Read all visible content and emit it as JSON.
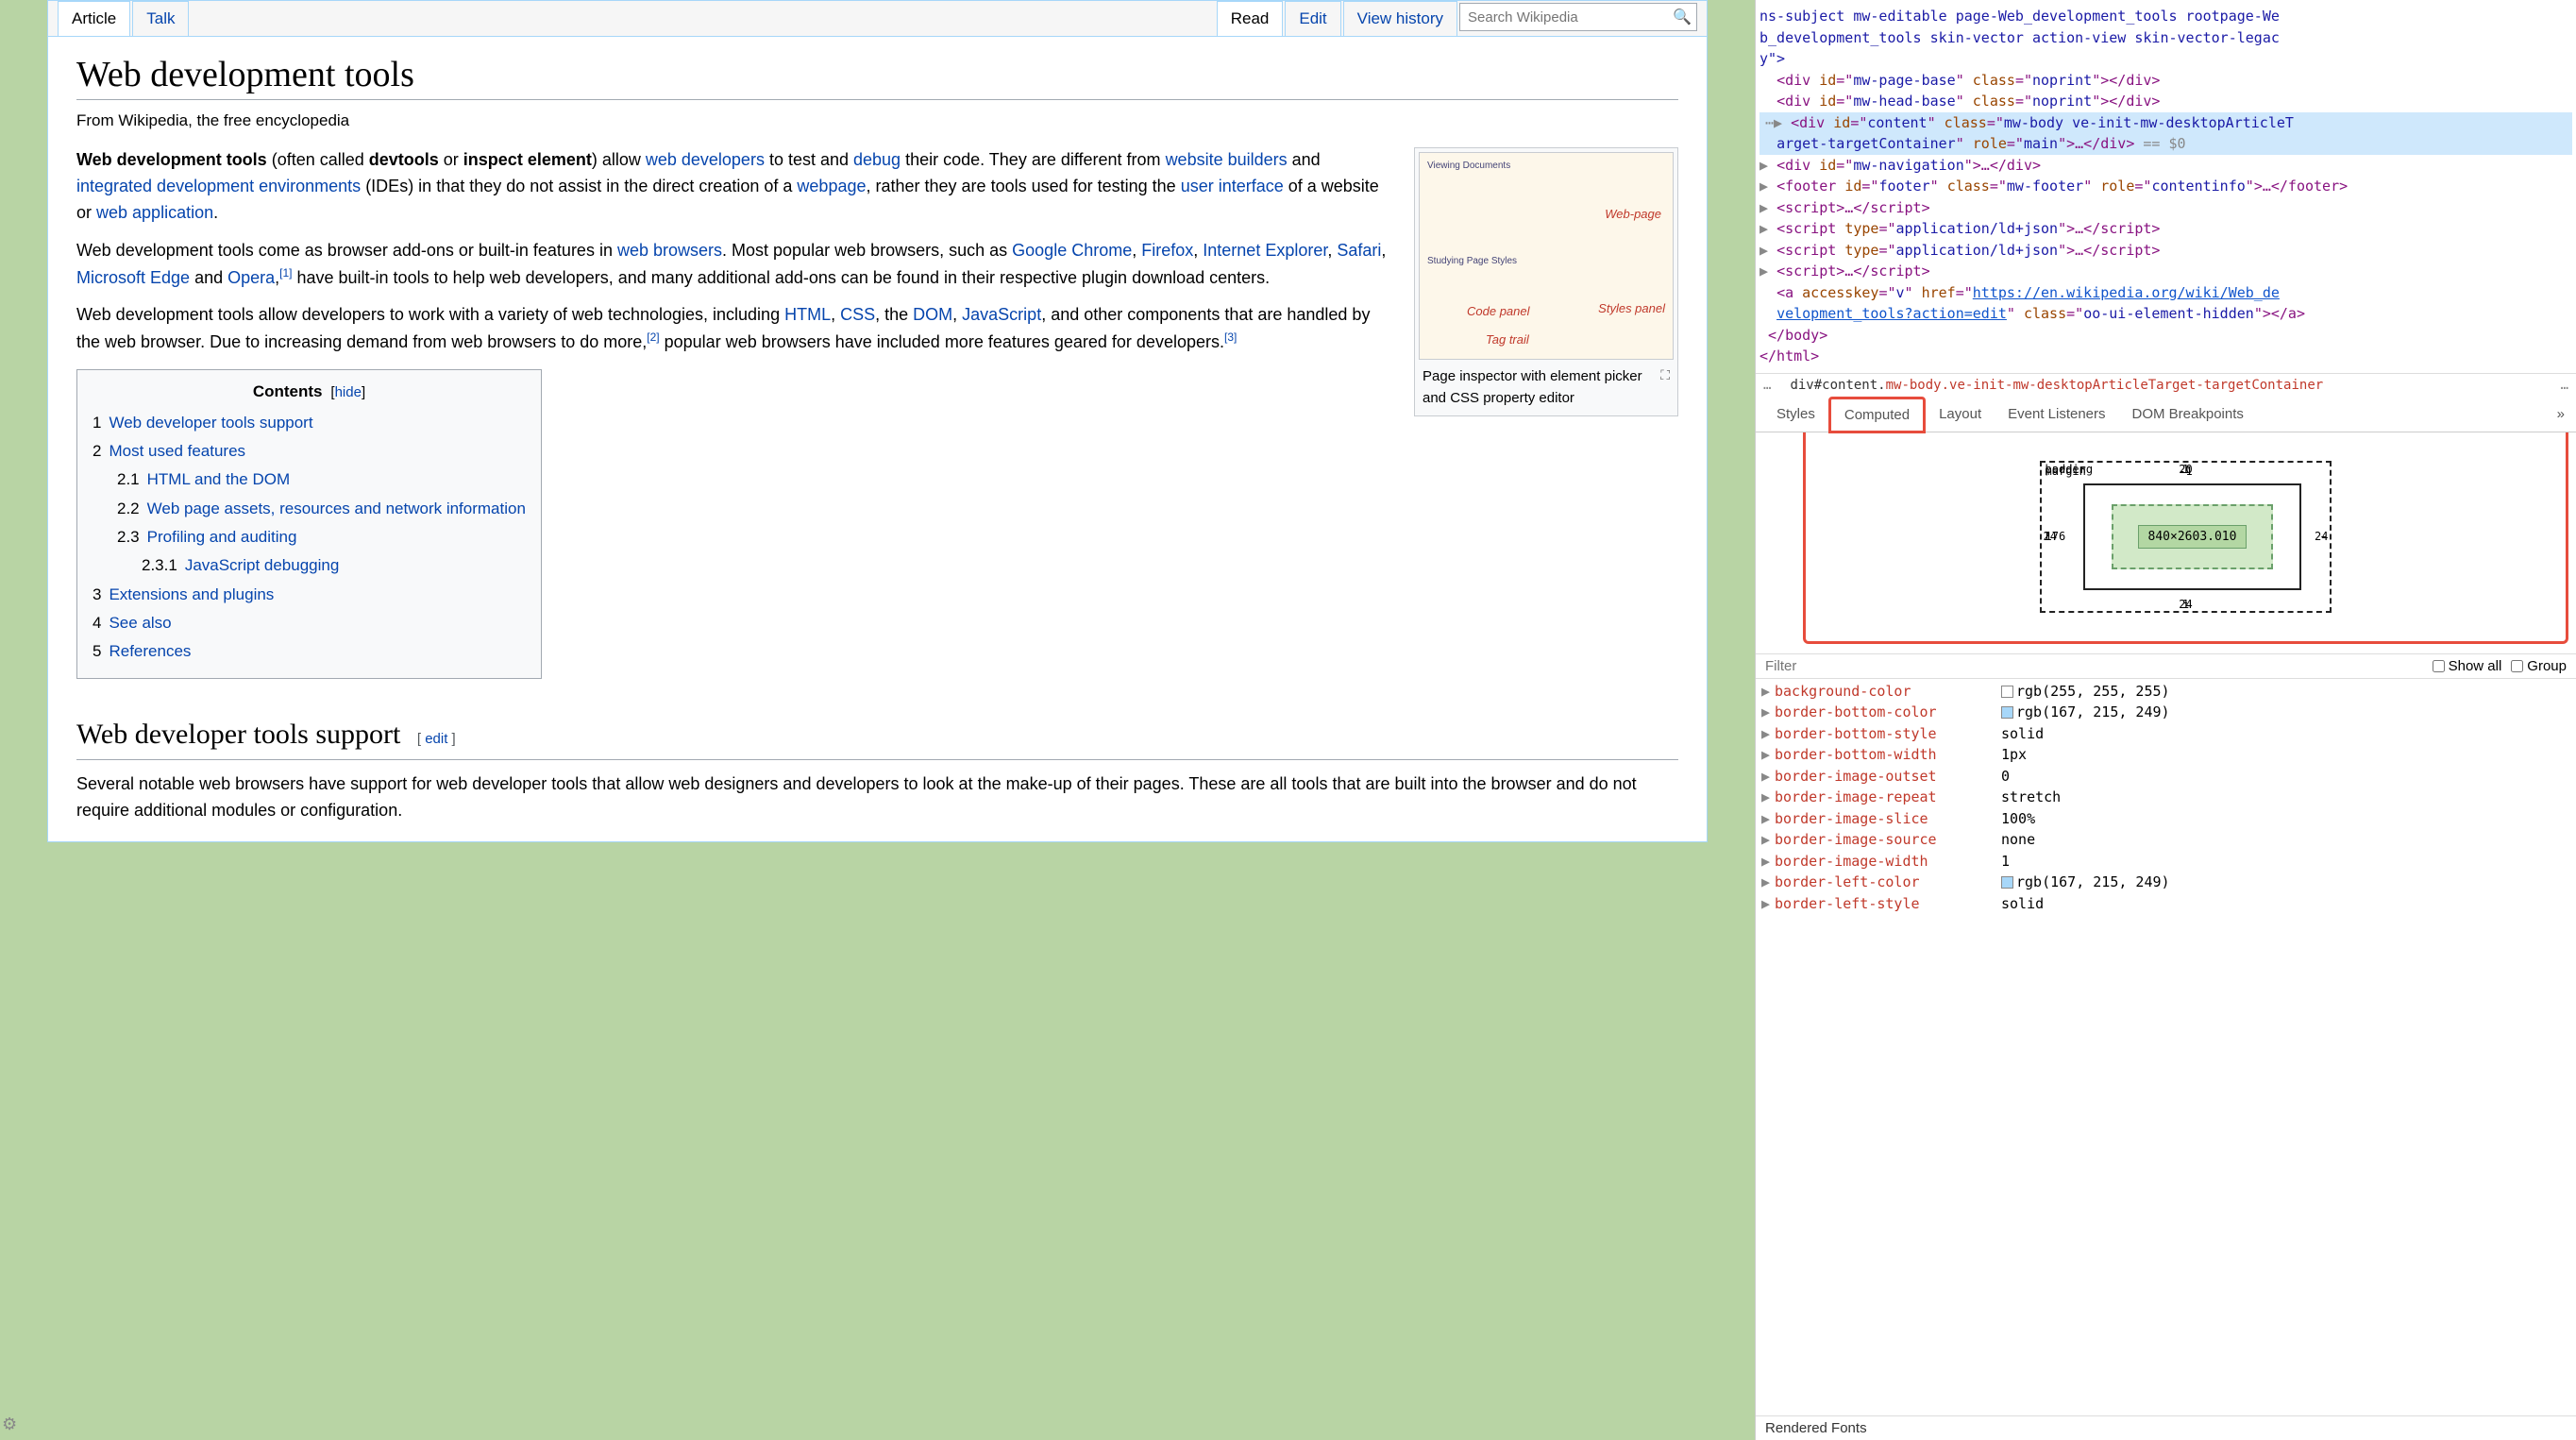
{
  "tabs": {
    "article": "Article",
    "talk": "Talk",
    "read": "Read",
    "edit": "Edit",
    "history": "View history"
  },
  "search": {
    "placeholder": "Search Wikipedia"
  },
  "title": "Web development tools",
  "subtitle": "From Wikipedia, the free encyclopedia",
  "para1": {
    "bold1": "Web development tools",
    "t1": " (often called ",
    "bold2": "devtools",
    "t2": " or ",
    "bold3": "inspect element",
    "t3": ") allow ",
    "link1": "web developers",
    "t4": " to test and ",
    "link2": "debug",
    "t5": " their code. They are different from ",
    "link3": "website builders",
    "t6": " and ",
    "link4": "integrated development environments",
    "t7": " (IDEs) in that they do not assist in the direct creation of a ",
    "link5": "webpage",
    "t8": ", rather they are tools used for testing the ",
    "link6": "user interface",
    "t9": " of a website or ",
    "link7": "web application",
    "t10": "."
  },
  "para2": {
    "t1": "Web development tools come as browser add-ons or built-in features in ",
    "l1": "web browsers",
    "t2": ". Most popular web browsers, such as ",
    "l2": "Google Chrome",
    "c1": ", ",
    "l3": "Firefox",
    "c2": ", ",
    "l4": "Internet Explorer",
    "c3": ", ",
    "l5": "Safari",
    "c4": ", ",
    "l6": "Microsoft Edge",
    "t3": " and ",
    "l7": "Opera",
    "c5": ",",
    "sup1": "[1]",
    "t4": " have built-in tools to help web developers, and many additional add-ons can be found in their respective plugin download centers."
  },
  "para3": {
    "t1": "Web development tools allow developers to work with a variety of web technologies, including ",
    "l1": "HTML",
    "c1": ", ",
    "l2": "CSS",
    "t2": ", the ",
    "l3": "DOM",
    "c2": ", ",
    "l4": "JavaScript",
    "t3": ", and other components that are handled by the web browser. Due to increasing demand from web browsers to do more,",
    "sup2": "[2]",
    "t4": " popular web browsers have included more features geared for developers.",
    "sup3": "[3]"
  },
  "thumb": {
    "webpage": "Web-page",
    "code": "Code panel",
    "styles": "Styles panel",
    "tagtrail": "Tag trail",
    "viewdoc": "Viewing Documents",
    "studystyles": "Studying Page Styles",
    "caption": "Page inspector with element picker and CSS property editor"
  },
  "toc": {
    "title": "Contents",
    "hide": "hide",
    "i1n": "1",
    "i1": "Web developer tools support",
    "i2n": "2",
    "i2": "Most used features",
    "i21n": "2.1",
    "i21": "HTML and the DOM",
    "i22n": "2.2",
    "i22": "Web page assets, resources and network information",
    "i23n": "2.3",
    "i23": "Profiling and auditing",
    "i231n": "2.3.1",
    "i231": "JavaScript debugging",
    "i3n": "3",
    "i3": "Extensions and plugins",
    "i4n": "4",
    "i4": "See also",
    "i5n": "5",
    "i5": "References"
  },
  "h2": {
    "title": "Web developer tools support",
    "lb": "[ ",
    "edit": "edit",
    "rb": " ]"
  },
  "para4": "Several notable web browsers have support for web developer tools that allow web designers and developers to look at the make-up of their pages. These are all tools that are built into the browser and do not require additional modules or configuration.",
  "dom": {
    "l0": "ns-subject mw-editable page-Web_development_tools rootpage-We",
    "l0b": "b_development_tools skin-vector action-view skin-vector-legac",
    "l0c": "y\">",
    "l1a": "<div ",
    "l1b": "id",
    "l1c": "=\"",
    "l1d": "mw-page-base",
    "l1e": "\" ",
    "l1f": "class",
    "l1g": "=\"",
    "l1h": "noprint",
    "l1i": "\"></div>",
    "l2d": "mw-head-base",
    "l2h": "noprint",
    "l3d": "content",
    "l3h": "mw-body ve-init-mw-desktopArticleT",
    "l3h2": "arget-targetContainer",
    "l3r": "role",
    "l3rv": "main",
    "l3end": ">…</div>",
    "l3eq": " == $0",
    "l4d": "mw-navigation",
    "l4e": ">…</div>",
    "l5a": "<footer ",
    "l5d": "footer",
    "l5h": "mw-footer",
    "l5rv": "contentinfo",
    "l5e": ">…</footer>",
    "l6": "<script>…</script>",
    "l7a": "<script ",
    "l7t": "type",
    "l7v": "application/ld+json",
    "l7e": ">…</script>",
    "l9": "<script>…</script>",
    "l10a": "<a ",
    "l10ak": "accesskey",
    "l10av": "v",
    "l10hk": "href",
    "l10hv": "https://en.wikipedia.org/wiki/Web_de",
    "l10hv2": "velopment_tools?action=edit",
    "l10ck": "class",
    "l10cv": "oo-ui-element-hidden",
    "l10e": "></a>",
    "l11": "</body>",
    "l12": "</html>"
  },
  "crumb": {
    "more": "…",
    "p1": "div#content.",
    "p2": "mw-body.ve-init-mw-desktopArticleTarget-targetContainer"
  },
  "ptabs": {
    "styles": "Styles",
    "computed": "Computed",
    "layout": "Layout",
    "events": "Event Listeners",
    "dom": "DOM Breakpoints",
    "more": "»"
  },
  "boxmodel": {
    "margin": "margin",
    "border": "border",
    "padding": "padding",
    "mtop": "-1",
    "mleft": "176",
    "mright": "-",
    "mbottom": "-",
    "btop": "1",
    "bleft": "1",
    "bright": "-",
    "bbottom": "1",
    "ptop": "20",
    "pleft": "24",
    "pright": "24",
    "pbottom": "24",
    "content": "840×2603.010"
  },
  "filter": {
    "placeholder": "Filter",
    "showall": "Show all",
    "group": "Group"
  },
  "props": [
    {
      "name": "background-color",
      "value": "rgb(255, 255, 255)",
      "swatch": "#ffffff"
    },
    {
      "name": "border-bottom-color",
      "value": "rgb(167, 215, 249)",
      "swatch": "#a7d7f9"
    },
    {
      "name": "border-bottom-style",
      "value": "solid"
    },
    {
      "name": "border-bottom-width",
      "value": "1px"
    },
    {
      "name": "border-image-outset",
      "value": "0"
    },
    {
      "name": "border-image-repeat",
      "value": "stretch"
    },
    {
      "name": "border-image-slice",
      "value": "100%"
    },
    {
      "name": "border-image-source",
      "value": "none"
    },
    {
      "name": "border-image-width",
      "value": "1"
    },
    {
      "name": "border-left-color",
      "value": "rgb(167, 215, 249)",
      "swatch": "#a7d7f9"
    },
    {
      "name": "border-left-style",
      "value": "solid"
    }
  ],
  "footer": "Rendered Fonts"
}
